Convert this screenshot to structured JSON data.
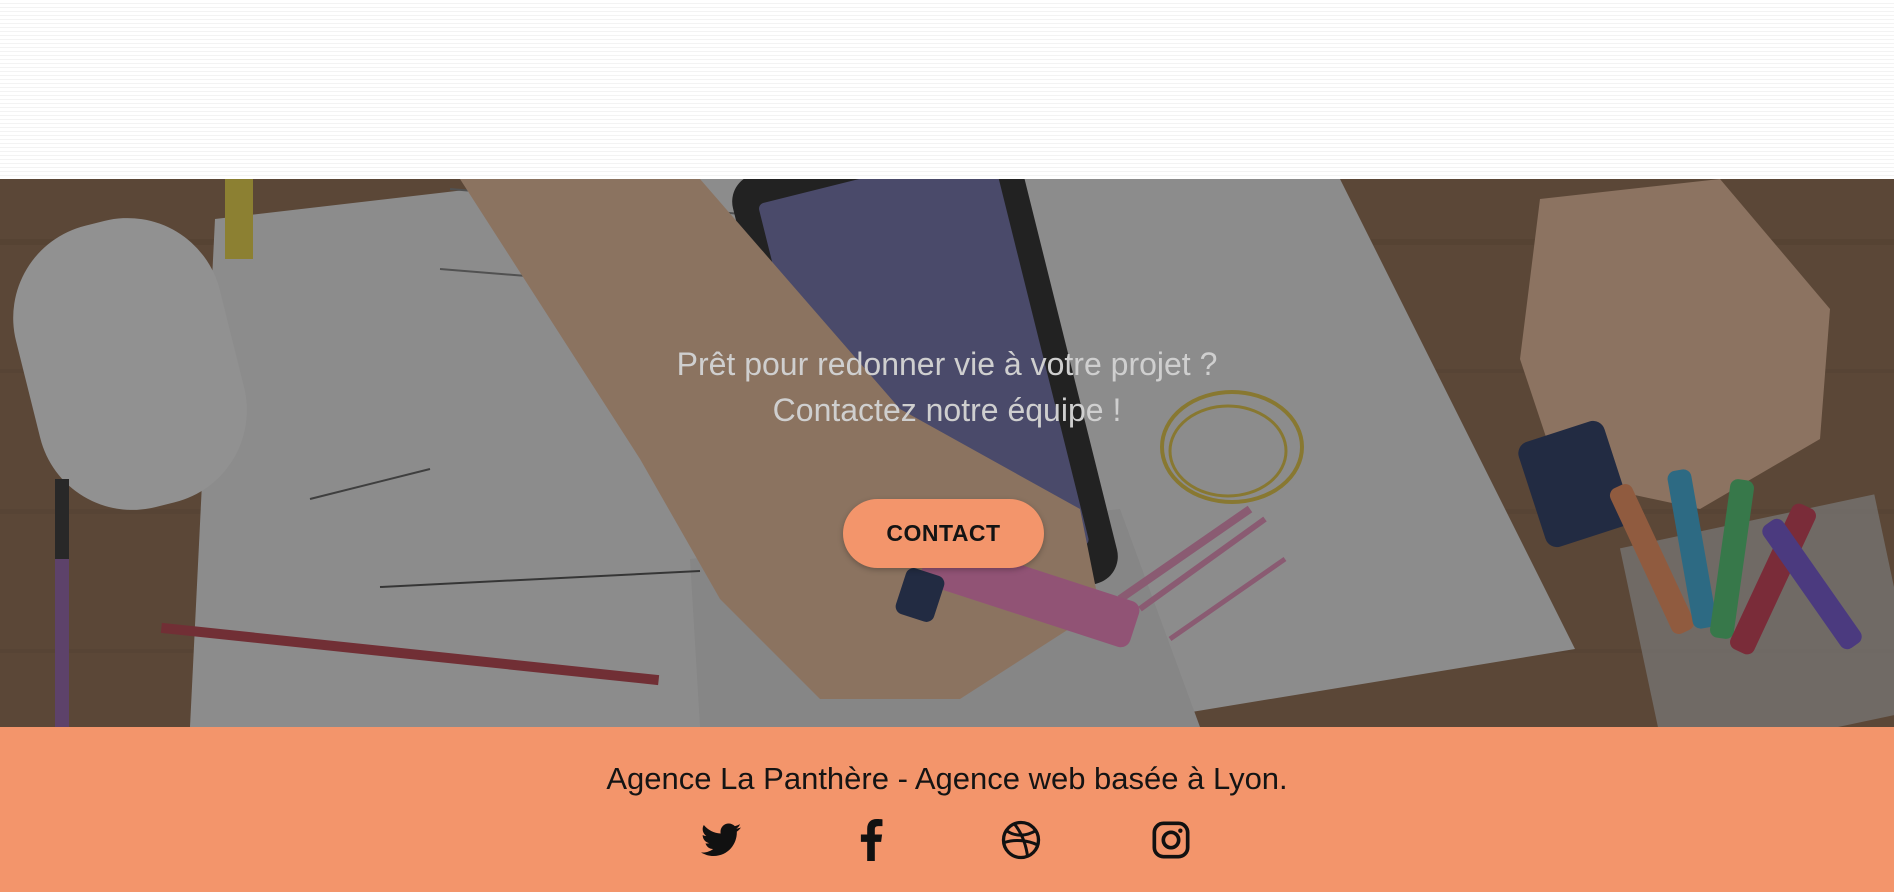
{
  "hero": {
    "line1": "Prêt pour redonner vie à votre projet ?",
    "line2": "Contactez notre équipe !",
    "button_label": "CONTACT"
  },
  "footer": {
    "tagline": "Agence La Panthère - Agence web basée à Lyon.",
    "social": [
      {
        "name": "twitter",
        "icon": "twitter-icon"
      },
      {
        "name": "facebook",
        "icon": "facebook-icon"
      },
      {
        "name": "dribbble",
        "icon": "dribbble-icon"
      },
      {
        "name": "instagram",
        "icon": "instagram-icon"
      }
    ]
  },
  "colors": {
    "accent": "#f3956b",
    "text_dark": "#141414",
    "hero_text": "#cfcfcf"
  }
}
